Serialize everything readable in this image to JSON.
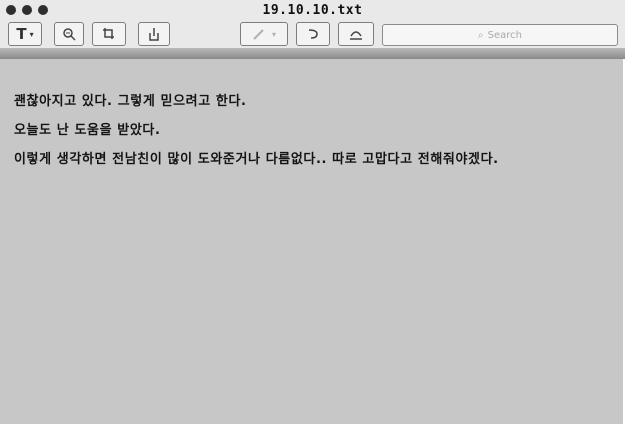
{
  "window": {
    "title": "19.10.10.txt"
  },
  "toolbar": {
    "format_label": "T",
    "search_placeholder": "Search"
  },
  "document": {
    "lines": [
      "괜찮아지고 있다. 그렇게 믿으려고 한다.",
      "오늘도 난 도움을 받았다.",
      "이렇게 생각하면 전남친이 많이 도와준거나 다름없다.. 따로 고맙다고 전해줘야겠다."
    ]
  },
  "colors": {
    "background": "#c7c7c7",
    "toolbar": "#e9e9e9",
    "text": "#141414"
  }
}
